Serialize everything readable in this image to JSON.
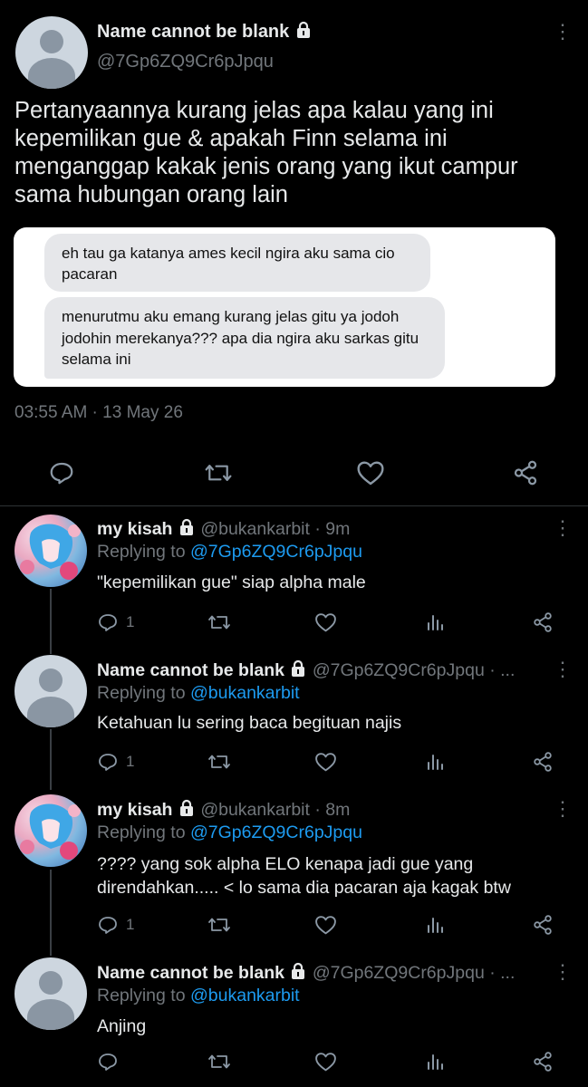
{
  "main_tweet": {
    "display_name": "Name cannot be blank",
    "handle": "@7Gp6ZQ9Cr6pJpqu",
    "text": "Pertanyaannya kurang jelas apa kalau yang ini kepemilikan gue & apakah Finn selama ini menganggap kakak jenis orang yang ikut campur sama hubungan orang lain",
    "chat_bubbles": [
      "eh tau ga katanya ames kecil ngira aku sama cio pacaran",
      "menurutmu aku emang kurang jelas gitu ya jodoh jodohin merekanya??? apa dia ngira aku sarkas gitu selama ini"
    ],
    "timestamp": "03:55 AM · 13 May 26"
  },
  "replies": [
    {
      "display_name": "my kisah",
      "handle_time": "@bukankarbit · 9m",
      "replying_prefix": "Replying to",
      "replying_to": "@7Gp6ZQ9Cr6pJpqu",
      "text": "\"kepemilikan gue\" siap alpha male",
      "reply_count": "1"
    },
    {
      "display_name": "Name cannot be blank",
      "handle_time": "@7Gp6ZQ9Cr6pJpqu · ...",
      "replying_prefix": "Replying to",
      "replying_to": "@bukankarbit",
      "text": "Ketahuan lu sering baca begituan najis",
      "reply_count": "1"
    },
    {
      "display_name": "my kisah",
      "handle_time": "@bukankarbit · 8m",
      "replying_prefix": "Replying to",
      "replying_to": "@7Gp6ZQ9Cr6pJpqu",
      "text_line1": "???? yang sok alpha ELO kenapa jadi gue yang",
      "text_line2": "direndahkan..... < lo sama dia pacaran aja kagak btw",
      "reply_count": "1"
    },
    {
      "display_name": "Name cannot be blank",
      "handle_time": "@7Gp6ZQ9Cr6pJpqu · ...",
      "replying_prefix": "Replying to",
      "replying_to": "@bukankarbit",
      "text": "Anjing"
    }
  ],
  "colors": {
    "background": "#000000",
    "text": "#e7e9ea",
    "secondary": "#71767b",
    "link": "#1d9bf0",
    "bubble": "#e6e7ea"
  }
}
